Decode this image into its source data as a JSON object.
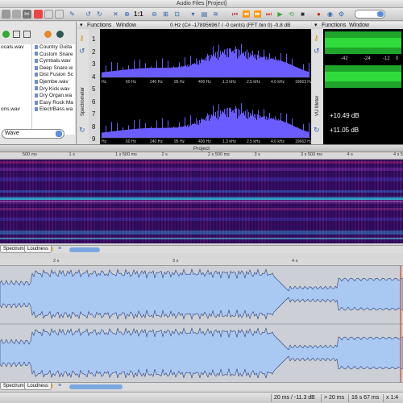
{
  "window": {
    "title": "Audio Files [Project]"
  },
  "toolbar": {
    "icons": [
      "new-icon",
      "open-icon",
      "save-icon",
      "cut-icon",
      "copy-icon",
      "paste-icon",
      "undo-icon",
      "redo-icon",
      "zoom-in-icon",
      "zoom-out-icon",
      "zoom-fit-icon",
      "play-icon",
      "loop-icon",
      "stop-icon",
      "record-icon",
      "settings-icon"
    ],
    "zoom_label": "1:1"
  },
  "left_panel": {
    "col_a": [
      "ocals.wav",
      "",
      "",
      "",
      "",
      "",
      "",
      "",
      "",
      "ons.wav",
      "",
      "",
      ""
    ],
    "col_b": [
      "Country Guita",
      "Custom Snare",
      "Cymbals.wav",
      "Deep Snare.w",
      "Dist Fusion Sc",
      "Djembe.wav",
      "Dry Kick.wav",
      "Dry Organ.wa",
      "Easy Rock Ma",
      "ElectrBass.wa"
    ],
    "format_select": "Wave"
  },
  "spectrometer": {
    "menu_functions": "Functions",
    "menu_window": "Window",
    "readout": "0 Hz (C# -178956967 / -0 cents) (FFT bin 0) -0.8 dB",
    "side_label": "Spectrometer",
    "side_numbers": [
      "1",
      "2",
      "3",
      "4",
      "5",
      "6",
      "7",
      "8",
      "9"
    ],
    "freq_labels": [
      "Hz",
      "60 Hz",
      "240 Hz",
      "95 Hz",
      "400 Hz",
      "1.3 kHz",
      "2.5 kHz",
      "4.6 kHz",
      "19663 Hz"
    ]
  },
  "vu_meter": {
    "menu_functions": "Functions",
    "menu_window": "Window",
    "side_label": "VU Meter",
    "scale": [
      "-42",
      "-24",
      "-12",
      "0"
    ],
    "level_left": "+10.49 dB",
    "level_right": "+11.05 dB"
  },
  "project_bar": {
    "label": "Project"
  },
  "ruler_top": [
    "500 ms",
    "1 s",
    "1 s 500 ms",
    "2 s",
    "2 s 500 ms",
    "3 s",
    "3 s 500 ms",
    "4 s",
    "4 s 500"
  ],
  "ruler_wave": [
    "2 s",
    "3 s",
    "4 s"
  ],
  "tabs_spec": [
    "Spectrum",
    "Loudness"
  ],
  "tabs_wave": [
    "Spectrum",
    "Loudness"
  ],
  "status": {
    "cursor": "20 ms / -11.3 dB",
    "selection": "> 20 ms",
    "length": "16 s 67 ms",
    "zoom": "x 1:4"
  },
  "colors": {
    "spectrum_fill": "#6a5cff",
    "waveform_fill": "#a9c8f2",
    "vu_green": "#2fcf3a",
    "spectrogram_bg": "#2a0a5a"
  }
}
